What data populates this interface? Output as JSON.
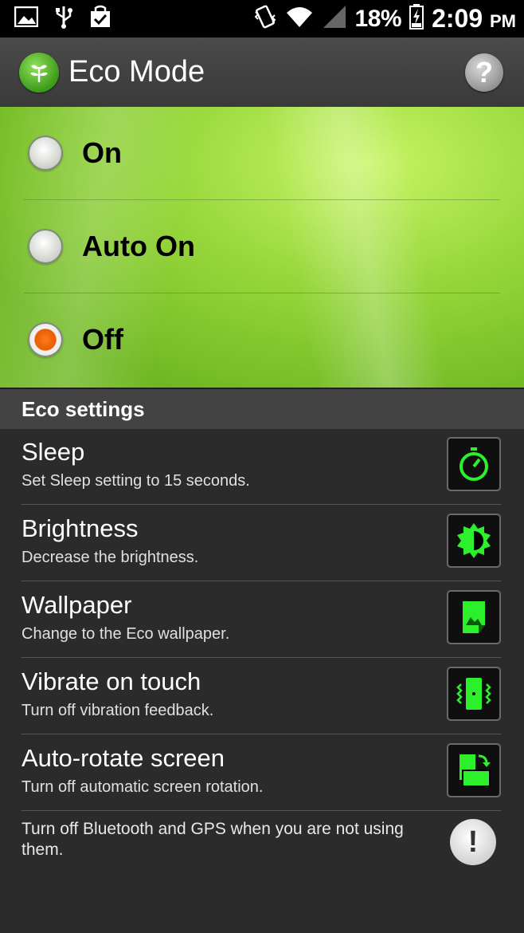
{
  "status_bar": {
    "battery": "18%",
    "time": "2:09",
    "ampm": "PM",
    "icons": [
      "image-icon",
      "usb-icon",
      "bag-check-icon",
      "vibrate-icon",
      "wifi-icon",
      "signal-icon",
      "battery-charging-icon"
    ]
  },
  "app": {
    "title": "Eco Mode",
    "icon": "leaf-icon",
    "help_label": "?"
  },
  "modes": {
    "items": [
      {
        "label": "On",
        "checked": false
      },
      {
        "label": "Auto On",
        "checked": false
      },
      {
        "label": "Off",
        "checked": true
      }
    ]
  },
  "eco_settings": {
    "header": "Eco settings",
    "items": [
      {
        "title": "Sleep",
        "desc": "Set Sleep setting to 15 seconds.",
        "icon": "stopwatch-icon"
      },
      {
        "title": "Brightness",
        "desc": "Decrease the brightness.",
        "icon": "brightness-icon"
      },
      {
        "title": "Wallpaper",
        "desc": "Change to the Eco wallpaper.",
        "icon": "wallpaper-icon"
      },
      {
        "title": "Vibrate on touch",
        "desc": "Turn off vibration feedback.",
        "icon": "vibrate-phone-icon"
      },
      {
        "title": "Auto-rotate screen",
        "desc": "Turn off automatic screen rotation.",
        "icon": "rotate-screen-icon"
      }
    ],
    "tip": "Turn off Bluetooth and GPS when you are not using them.",
    "tip_icon_label": "!"
  },
  "colors": {
    "accent_green": "#2cf02c",
    "radio_checked": "#e85d00"
  }
}
